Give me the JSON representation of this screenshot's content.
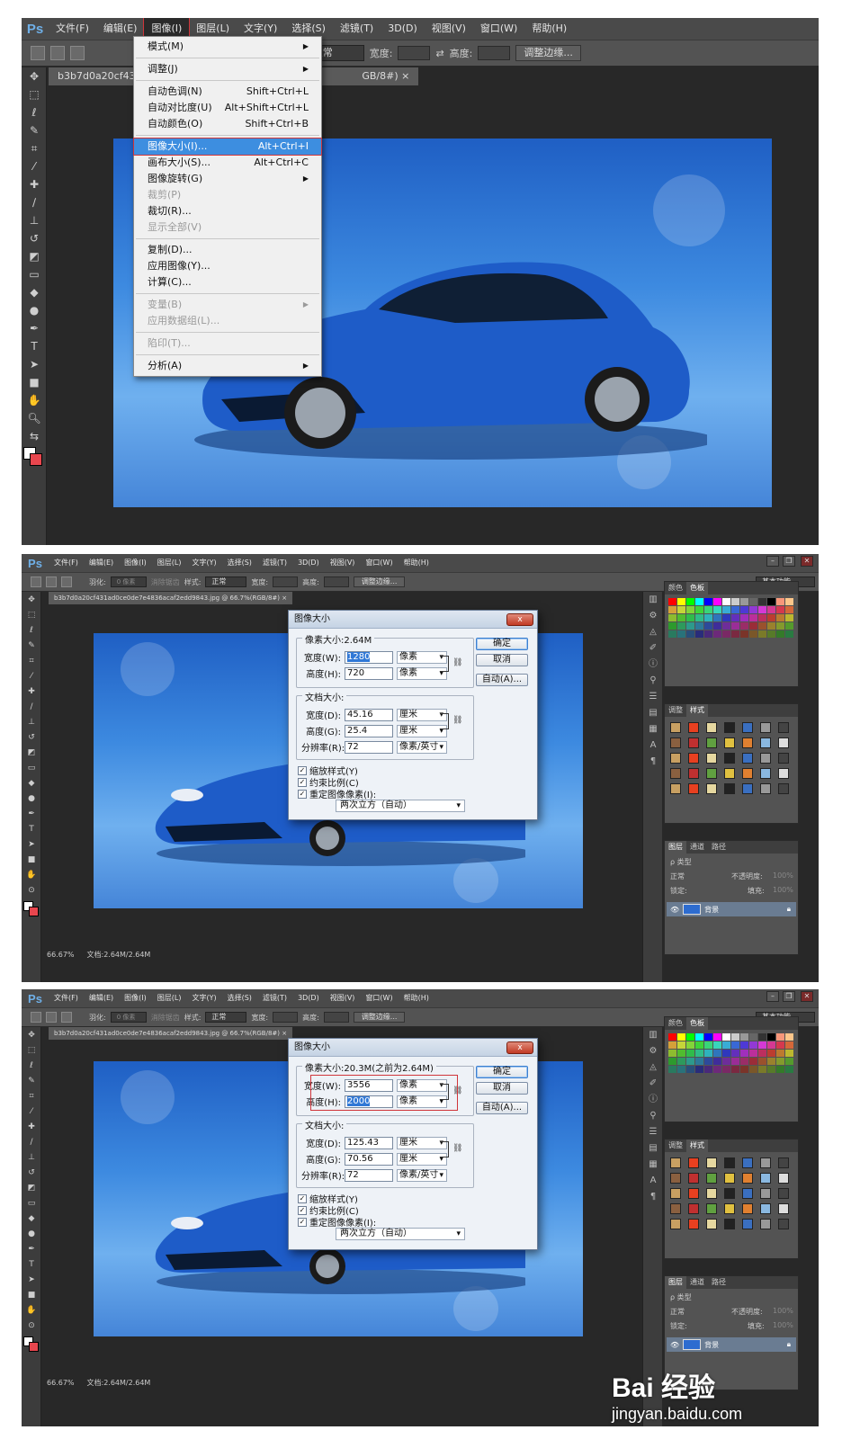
{
  "app": {
    "logo": "Ps"
  },
  "menu_s1": [
    "文件(F)",
    "编辑(E)",
    "图像(I)",
    "图层(L)",
    "文字(Y)",
    "选择(S)",
    "滤镜(T)",
    "3D(D)",
    "视图(V)",
    "窗口(W)",
    "帮助(H)"
  ],
  "menu_small": [
    "文件(F)",
    "编辑(E)",
    "图像(I)",
    "图层(L)",
    "文字(Y)",
    "选择(S)",
    "滤镜(T)",
    "3D(D)",
    "视图(V)",
    "窗口(W)",
    "帮助(H)"
  ],
  "options_s1": {
    "style_label": "式:",
    "style_value": "正常",
    "width_label": "宽度:",
    "height_label": "高度:",
    "refine_edge": "调整边缘..."
  },
  "options_small": {
    "feather_label": "羽化:",
    "feather_value": "0 像素",
    "antialias": "消除锯齿",
    "style_label": "样式:",
    "style_value": "正常",
    "width_label": "宽度:",
    "height_label": "高度:",
    "refine_edge": "调整边缘...",
    "workspace": "基本功能"
  },
  "doc_tab_s1": "b3b7d0a20cf431a",
  "doc_tab_s1_tail": "GB/8#)",
  "doc_tab_small": "b3b7d0a20cf431ad0ce0de7e4836acaf2edd9843.jpg @ 66.7%(RGB/8#)",
  "image_menu": {
    "items": [
      {
        "label": "模式(M)",
        "submenu": true
      },
      {
        "sep": true
      },
      {
        "label": "调整(J)",
        "submenu": true
      },
      {
        "sep": true
      },
      {
        "label": "自动色调(N)",
        "shortcut": "Shift+Ctrl+L"
      },
      {
        "label": "自动对比度(U)",
        "shortcut": "Alt+Shift+Ctrl+L"
      },
      {
        "label": "自动颜色(O)",
        "shortcut": "Shift+Ctrl+B"
      },
      {
        "sep": true
      },
      {
        "label": "图像大小(I)...",
        "shortcut": "Alt+Ctrl+I",
        "selected": true
      },
      {
        "label": "画布大小(S)...",
        "shortcut": "Alt+Ctrl+C"
      },
      {
        "label": "图像旋转(G)",
        "submenu": true
      },
      {
        "label": "裁剪(P)",
        "disabled": true
      },
      {
        "label": "裁切(R)..."
      },
      {
        "label": "显示全部(V)",
        "disabled": true
      },
      {
        "sep": true
      },
      {
        "label": "复制(D)..."
      },
      {
        "label": "应用图像(Y)..."
      },
      {
        "label": "计算(C)..."
      },
      {
        "sep": true
      },
      {
        "label": "变量(B)",
        "submenu": true,
        "disabled": true
      },
      {
        "label": "应用数据组(L)...",
        "disabled": true
      },
      {
        "sep": true
      },
      {
        "label": "陷印(T)...",
        "disabled": true
      },
      {
        "sep": true
      },
      {
        "label": "分析(A)",
        "submenu": true
      }
    ]
  },
  "dialog1": {
    "title": "图像大小",
    "close": "x",
    "pixel_group": "像素大小:2.64M",
    "width_label": "宽度(W):",
    "width_value": "1280",
    "width_unit": "像素",
    "height_label": "高度(H):",
    "height_value": "720",
    "height_unit": "像素",
    "doc_group": "文档大小:",
    "doc_width_label": "宽度(D):",
    "doc_width_value": "45.16",
    "doc_width_unit": "厘米",
    "doc_height_label": "高度(G):",
    "doc_height_value": "25.4",
    "doc_height_unit": "厘米",
    "res_label": "分辨率(R):",
    "res_value": "72",
    "res_unit": "像素/英寸",
    "ok": "确定",
    "cancel": "取消",
    "auto": "自动(A)...",
    "scale_styles": "缩放样式(Y)",
    "constrain": "约束比例(C)",
    "resample": "重定图像像素(I):",
    "resample_method": "两次立方（自动）"
  },
  "dialog2": {
    "title": "图像大小",
    "close": "x",
    "pixel_group": "像素大小:20.3M(之前为2.64M)",
    "width_label": "宽度(W):",
    "width_value": "3556",
    "width_unit": "像素",
    "height_label": "高度(H):",
    "height_value": "2000",
    "height_unit": "像素",
    "doc_group": "文档大小:",
    "doc_width_label": "宽度(D):",
    "doc_width_value": "125.43",
    "doc_width_unit": "厘米",
    "doc_height_label": "高度(G):",
    "doc_height_value": "70.56",
    "doc_height_unit": "厘米",
    "res_label": "分辨率(R):",
    "res_value": "72",
    "res_unit": "像素/英寸",
    "ok": "确定",
    "cancel": "取消",
    "auto": "自动(A)...",
    "scale_styles": "缩放样式(Y)",
    "constrain": "约束比例(C)",
    "resample": "重定图像像素(I):",
    "resample_method": "两次立方（自动）"
  },
  "panels": {
    "swatch_tabs": [
      "颜色",
      "色板"
    ],
    "style_tabs": [
      "调整",
      "样式"
    ],
    "layer_tabs": [
      "图层",
      "通道",
      "路径"
    ],
    "kind": "ρ 类型",
    "blend": "正常",
    "opacity_label": "不透明度:",
    "opacity_value": "100%",
    "lock_label": "锁定:",
    "fill_label": "填充:",
    "fill_value": "100%",
    "layer_name": "背景"
  },
  "status": {
    "zoom": "66.67%",
    "doc_info": "文档:2.64M/2.64M"
  },
  "watermark": {
    "logo": "Bai 经验",
    "url": "jingyan.baidu.com"
  }
}
